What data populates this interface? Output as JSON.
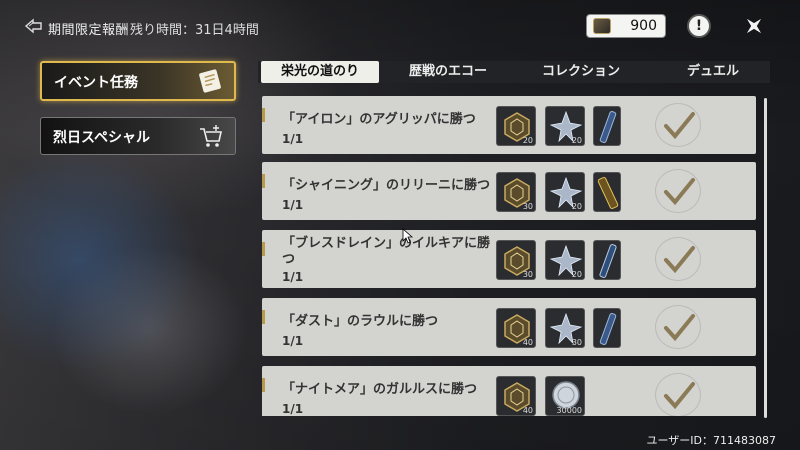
{
  "header": {
    "title": "期間限定報酬",
    "time_remaining": "残り時間：31日4時間",
    "currency_value": "900",
    "info_label": "!"
  },
  "sidebar": {
    "items": [
      {
        "label": "イベント任務",
        "active": true
      },
      {
        "label": "烈日スペシャル",
        "active": false
      }
    ]
  },
  "tabs": [
    {
      "label": "栄光の道のり",
      "active": true
    },
    {
      "label": "歴戦のエコー",
      "active": false
    },
    {
      "label": "コレクション",
      "active": false
    },
    {
      "label": "デュエル",
      "active": false
    }
  ],
  "missions": [
    {
      "title": "「アイロン」のアグリッパに勝つ",
      "progress": "1/1",
      "rewards": [
        {
          "icon": "medal-icon",
          "count": "20"
        },
        {
          "icon": "star-shard-icon",
          "count": "20"
        },
        {
          "icon": "blade-icon",
          "count": ""
        }
      ]
    },
    {
      "title": "「シャイニング」のリリーニに勝つ",
      "progress": "1/1",
      "rewards": [
        {
          "icon": "medal-icon",
          "count": "30"
        },
        {
          "icon": "star-shard-icon",
          "count": "20"
        },
        {
          "icon": "chain-icon",
          "count": ""
        }
      ]
    },
    {
      "title": "「ブレスドレイン」のイルキアに勝つ",
      "progress": "1/1",
      "rewards": [
        {
          "icon": "medal-icon",
          "count": "30"
        },
        {
          "icon": "star-shard-icon",
          "count": "20"
        },
        {
          "icon": "rifle-icon",
          "count": ""
        }
      ]
    },
    {
      "title": "「ダスト」のラウルに勝つ",
      "progress": "1/1",
      "rewards": [
        {
          "icon": "medal-icon",
          "count": "40"
        },
        {
          "icon": "star-shard-icon",
          "count": "30"
        },
        {
          "icon": "blade-icon",
          "count": ""
        }
      ]
    },
    {
      "title": "「ナイトメア」のガルルスに勝つ",
      "progress": "1/1",
      "rewards": [
        {
          "icon": "medal-icon",
          "count": "40"
        },
        {
          "icon": "coin-icon",
          "count": "30000"
        }
      ]
    }
  ],
  "footer": {
    "user_id": "ユーザーID：711483087"
  },
  "colors": {
    "accent_gold": "#e0b94e",
    "check_color": "#8a7a55",
    "row_bg": "#d3d3d0"
  }
}
